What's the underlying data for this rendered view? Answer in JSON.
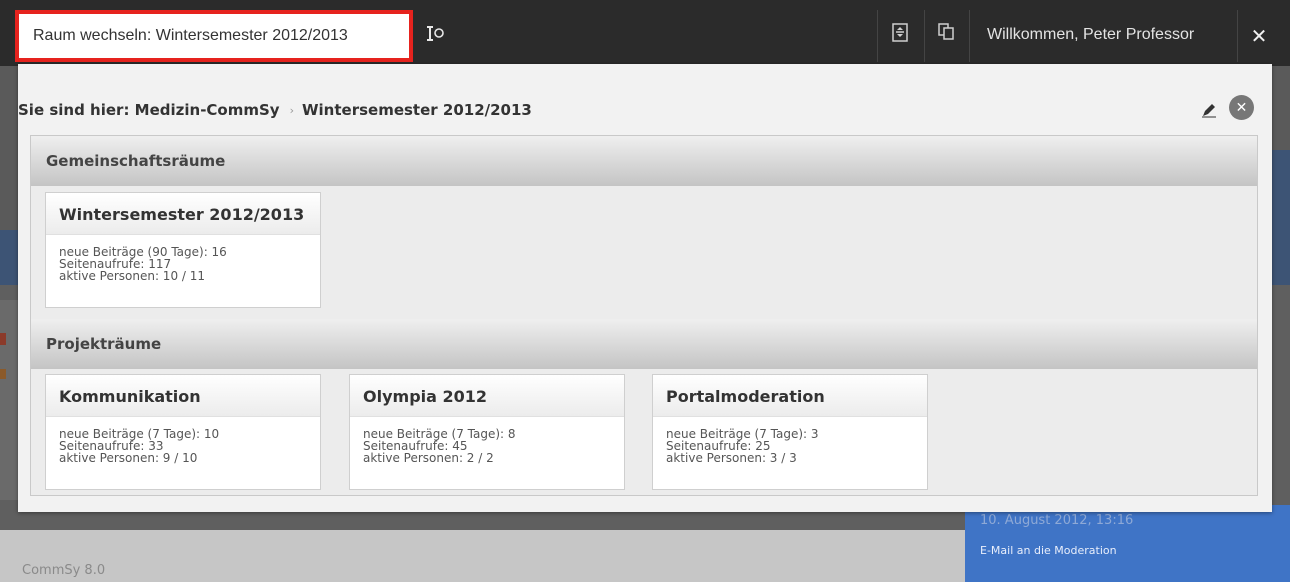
{
  "topbar": {
    "room_switch_label": "Raum wechseln: Wintersemester 2012/2013",
    "welcome": "Willkommen, Peter Professor",
    "icons": {
      "tool": "pin-tool-icon",
      "clipboard": "clipboard-icon",
      "copy": "copy-icon",
      "close": "close-icon"
    },
    "highlight_color": "#e6231e"
  },
  "panel": {
    "breadcrumb_prefix": "Sie sind hier: Medizin-CommSy",
    "breadcrumb_arrow": "›",
    "breadcrumb_current": "Wintersemester 2012/2013",
    "sections": {
      "community": "Gemeinschaftsräume",
      "projects": "Projekträume"
    },
    "community_rooms": [
      {
        "title": "Wintersemester 2012/2013",
        "stats": [
          "neue Beiträge (90 Tage): 16",
          "Seitenaufrufe: 117",
          "aktive Personen: 10 / 11"
        ]
      }
    ],
    "project_rooms": [
      {
        "title": "Kommunikation",
        "stats": [
          "neue Beiträge (7 Tage): 10",
          "Seitenaufrufe: 33",
          "aktive Personen: 9 / 10"
        ]
      },
      {
        "title": "Olympia 2012",
        "stats": [
          "neue Beiträge (7 Tage): 8",
          "Seitenaufrufe: 45",
          "aktive Personen: 2 / 2"
        ]
      },
      {
        "title": "Portalmoderation",
        "stats": [
          "neue Beiträge (7 Tage): 3",
          "Seitenaufrufe: 25",
          "aktive Personen: 3 / 3"
        ]
      }
    ]
  },
  "background": {
    "footer": "CommSy 8.0",
    "date": "10. August 2012, 13:16",
    "mail_link": "E-Mail an die Moderation"
  }
}
